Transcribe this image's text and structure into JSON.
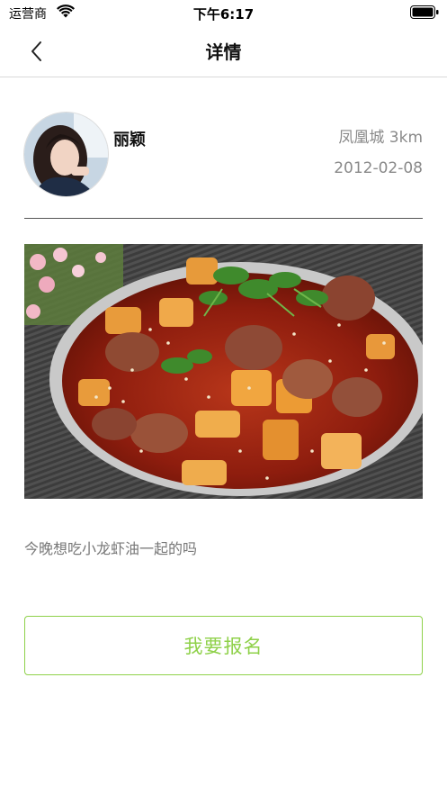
{
  "status_bar": {
    "carrier": "运营商",
    "time": "下午6:17"
  },
  "nav": {
    "title": "详情"
  },
  "post": {
    "username": "丽颖",
    "location": "凤凰城 3km",
    "date": "2012-02-08",
    "text": "今晚想吃小龙虾油一起的吗",
    "image": "dish-photo"
  },
  "action": {
    "signup_label": "我要报名"
  },
  "colors": {
    "accent": "#8fd14a",
    "muted_text": "#8a8a8a",
    "divider": "#555555"
  }
}
